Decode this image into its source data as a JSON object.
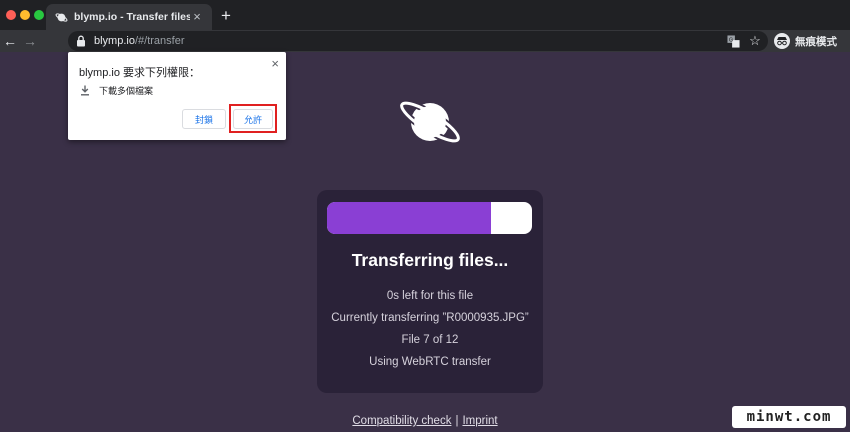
{
  "browser": {
    "tab": {
      "title": "blymp.io - Transfer files",
      "close_icon": "×",
      "favicon": "planet-icon"
    },
    "new_tab_label": "+",
    "nav": {
      "back": "←",
      "forward": "→",
      "reload": "↻"
    },
    "omnibox": {
      "host": "blymp.io",
      "path": "/#/transfer"
    },
    "bookmark_icon": "☆",
    "profile": {
      "label": "無痕模式"
    }
  },
  "permission_popup": {
    "title": "blymp.io 要求下列權限：",
    "close_icon": "×",
    "item": "下載多個檔案",
    "block_label": "封鎖",
    "allow_label": "允許"
  },
  "transfer": {
    "progress_percent": 80,
    "title": "Transferring files...",
    "time_left": "0s left for this file",
    "current_file": "Currently transferring ”R0000935.JPG”",
    "file_count": "File 7 of 12",
    "method": "Using WebRTC transfer"
  },
  "footer": {
    "link1": "Compatibility check",
    "separator": "|",
    "link2": "Imprint"
  },
  "watermark": "minwt.com",
  "colors": {
    "page_bg": "#3a3047",
    "card_bg": "#2a2238",
    "progress_fill": "#8a3fd4",
    "allow_highlight": "#e02020",
    "button_text": "#1a73e8"
  }
}
